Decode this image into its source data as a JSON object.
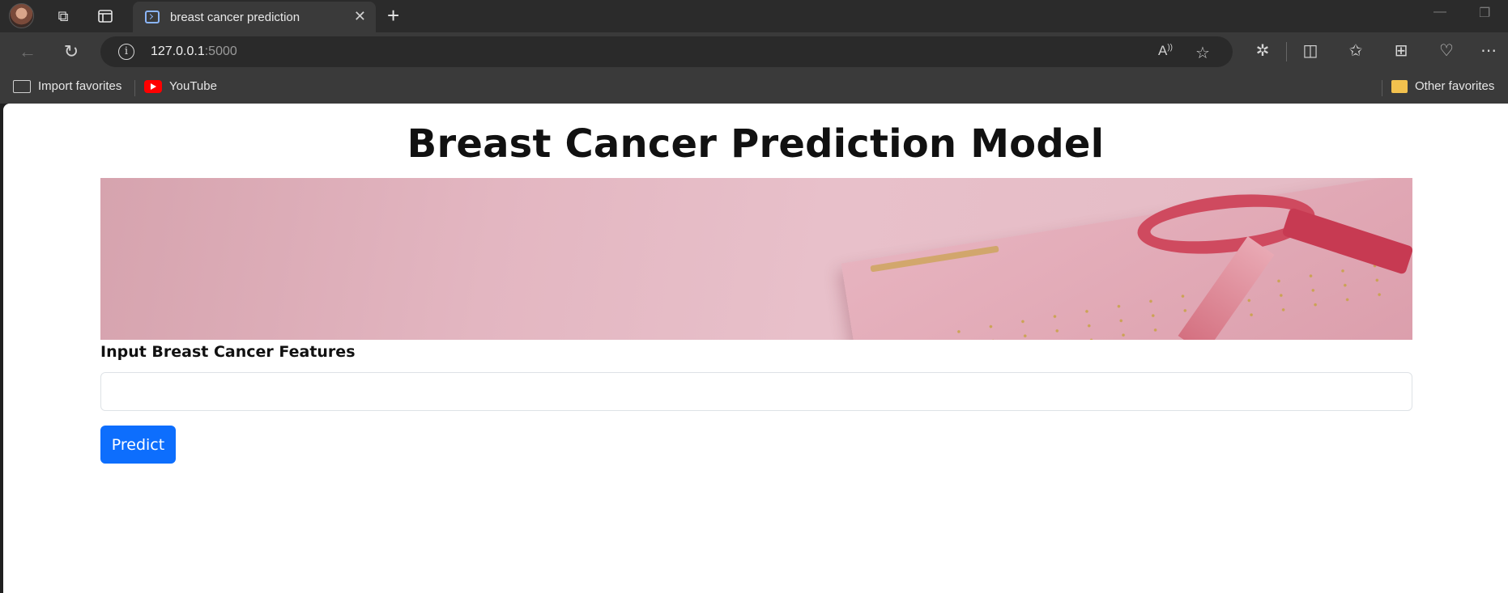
{
  "browser": {
    "tab": {
      "title": "breast cancer prediction",
      "close_glyph": "✕"
    },
    "new_tab_glyph": "+",
    "address": {
      "host": "127.0.0.1",
      "port": ":5000"
    },
    "favorites": [
      {
        "label": "Import favorites",
        "icon": "import-folder-icon"
      },
      {
        "label": "YouTube",
        "icon": "youtube-icon"
      }
    ],
    "other_favorites": {
      "label": "Other favorites",
      "icon": "folder-icon"
    }
  },
  "page": {
    "title": "Breast Cancer Prediction Model",
    "banner": {
      "subject": "pink ribbon with calendar",
      "accent": "#cf4a5f"
    },
    "form": {
      "label": "Input Breast Cancer Features",
      "input_value": "",
      "button_label": "Predict",
      "button_color": "#0d6efd"
    }
  }
}
